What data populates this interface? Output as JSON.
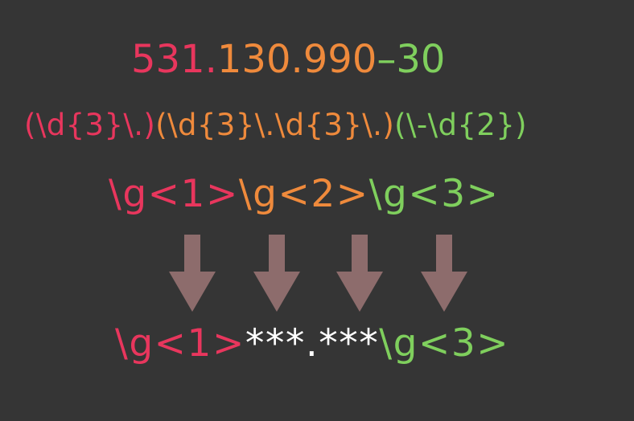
{
  "number_line": {
    "part1": "531.",
    "part2": "130.990",
    "part3": "–30"
  },
  "regex_line": {
    "group1": "(\\d{3}\\.)",
    "group2": "(\\d{3}\\.\\d{3}\\.)",
    "group3": "(\\-\\d{2})"
  },
  "groups_line": {
    "ref1": "\\g<1>",
    "ref2": "\\g<2>",
    "ref3": "\\g<3>"
  },
  "result_line": {
    "ref1": "\\g<1>",
    "masked": "***.***",
    "ref3": "\\g<3>"
  },
  "colors": {
    "group1": "#e8365d",
    "group2": "#ef8a3c",
    "group3": "#7fcf5d",
    "masked": "#ffffff",
    "arrow": "#8d6c6c",
    "background": "#353535"
  },
  "arrows": [
    {
      "icon": "arrow-down-icon"
    },
    {
      "icon": "arrow-down-icon"
    },
    {
      "icon": "arrow-down-icon"
    },
    {
      "icon": "arrow-down-icon"
    }
  ]
}
